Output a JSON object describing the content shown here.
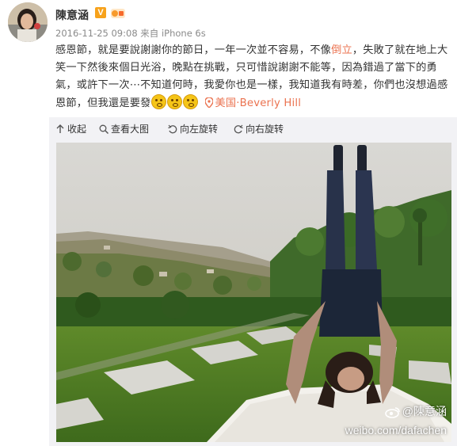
{
  "post": {
    "username": "陳意涵",
    "verified_badge": "V",
    "meta": {
      "timestamp": "2016-11-25 09:08",
      "source": "来自 iPhone 6s"
    },
    "text": {
      "part1": "感恩節，就是要說謝謝你的節日，一年一次並不容易，不像",
      "highlight": "倒立",
      "part2": "，失敗了就在地上大笑一下然後來個日光浴，晚點在挑戰，只可惜說謝謝不能等，因為錯過了當下的勇氣，或許下一次⋯不知道何時，我愛你也是一樣，我知道我有時差，你們也沒想過感恩節，但我還是要發"
    },
    "emoji_count": 3,
    "emoji_icon": "grinning-sweat-face-icon",
    "location": "美国·Beverly Hill"
  },
  "toolbar": {
    "collapse_label": "收起",
    "view_large_label": "查看大图",
    "rotate_left_label": "向左旋转",
    "rotate_right_label": "向右旋转"
  },
  "photo": {
    "watermark_handle": "@陳意涵",
    "watermark_url": "weibo.com/dafachen"
  },
  "colors": {
    "accent": "#eb7350",
    "verified": "#f7a21b",
    "toolbar_bg": "#f2f2f5"
  }
}
